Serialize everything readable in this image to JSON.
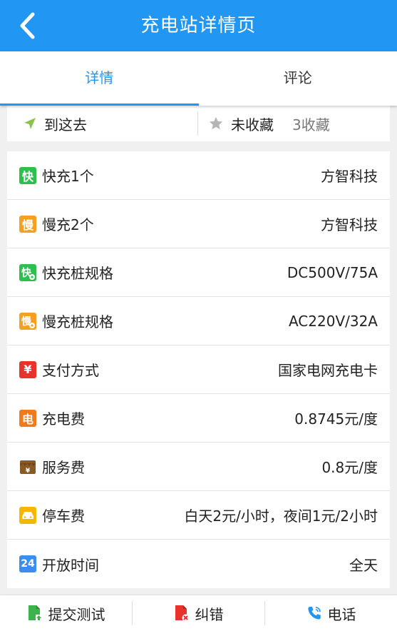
{
  "header": {
    "title": "充电站详情页"
  },
  "tabs": [
    {
      "label": "详情",
      "active": true
    },
    {
      "label": "评论",
      "active": false
    }
  ],
  "actions": {
    "navigate_label": "到这去",
    "favorite_label": "未收藏",
    "favorite_count": "3收藏"
  },
  "details": [
    {
      "icon": "fast-charge-icon",
      "label": "快充1个",
      "value": "方智科技"
    },
    {
      "icon": "slow-charge-icon",
      "label": "慢充2个",
      "value": "方智科技"
    },
    {
      "icon": "fast-spec-icon",
      "label": "快充桩规格",
      "value": "DC500V/75A"
    },
    {
      "icon": "slow-spec-icon",
      "label": "慢充桩规格",
      "value": "AC220V/32A"
    },
    {
      "icon": "yuan-icon",
      "label": "支付方式",
      "value": "国家电网充电卡"
    },
    {
      "icon": "electricity-icon",
      "label": "充电费",
      "value": "0.8745元/度"
    },
    {
      "icon": "service-fee-icon",
      "label": "服务费",
      "value": "0.8元/度"
    },
    {
      "icon": "car-icon",
      "label": "停车费",
      "value": "白天2元/小时，夜间1元/2小时"
    },
    {
      "icon": "clock-24-icon",
      "label": "开放时间",
      "value": "全天"
    }
  ],
  "icon_glyphs": {
    "fast": "快",
    "slow": "慢",
    "yuan": "¥",
    "electricity": "电",
    "hours": "24"
  },
  "bottom_bar": {
    "submit_label": "提交测试",
    "report_label": "纠错",
    "phone_label": "电话"
  },
  "colors": {
    "primary": "#2196f3",
    "green": "#2fbf4f",
    "orange": "#f5a020",
    "red": "#e8322c",
    "electric_orange": "#f07a1c",
    "brown": "#8a5a24",
    "yellow": "#f5b800",
    "blue": "#3a8ef0"
  }
}
